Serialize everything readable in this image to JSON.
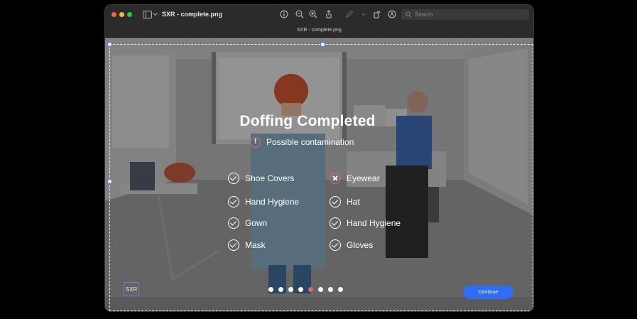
{
  "window": {
    "title": "SXR - complete.png",
    "tab_title": "SXR - complete.png",
    "search_placeholder": "Search"
  },
  "toolbar_icons": [
    "sidebar-icon",
    "info-icon",
    "zoom-out-icon",
    "zoom-in-icon",
    "share-icon",
    "markup-pen-icon",
    "rotate-icon",
    "annotate-icon",
    "search-icon"
  ],
  "overlay": {
    "heading": "Doffing Completed",
    "warning_icon": "!",
    "warning_text": "Possible contamination",
    "items_left": [
      {
        "label": "Shoe Covers",
        "status": "ok"
      },
      {
        "label": "Hand Hygiene",
        "status": "ok"
      },
      {
        "label": "Gown",
        "status": "ok"
      },
      {
        "label": "Mask",
        "status": "ok"
      }
    ],
    "items_right": [
      {
        "label": "Eyewear",
        "status": "fail"
      },
      {
        "label": "Hat",
        "status": "ok"
      },
      {
        "label": "Hand Hygiene",
        "status": "ok"
      },
      {
        "label": "Gloves",
        "status": "ok"
      }
    ],
    "pager": {
      "count": 8,
      "active": 5
    },
    "logo": "SXR",
    "continue_label": "Continue"
  },
  "colors": {
    "accent": "#2f6df6",
    "warning": "#e06a6a"
  }
}
